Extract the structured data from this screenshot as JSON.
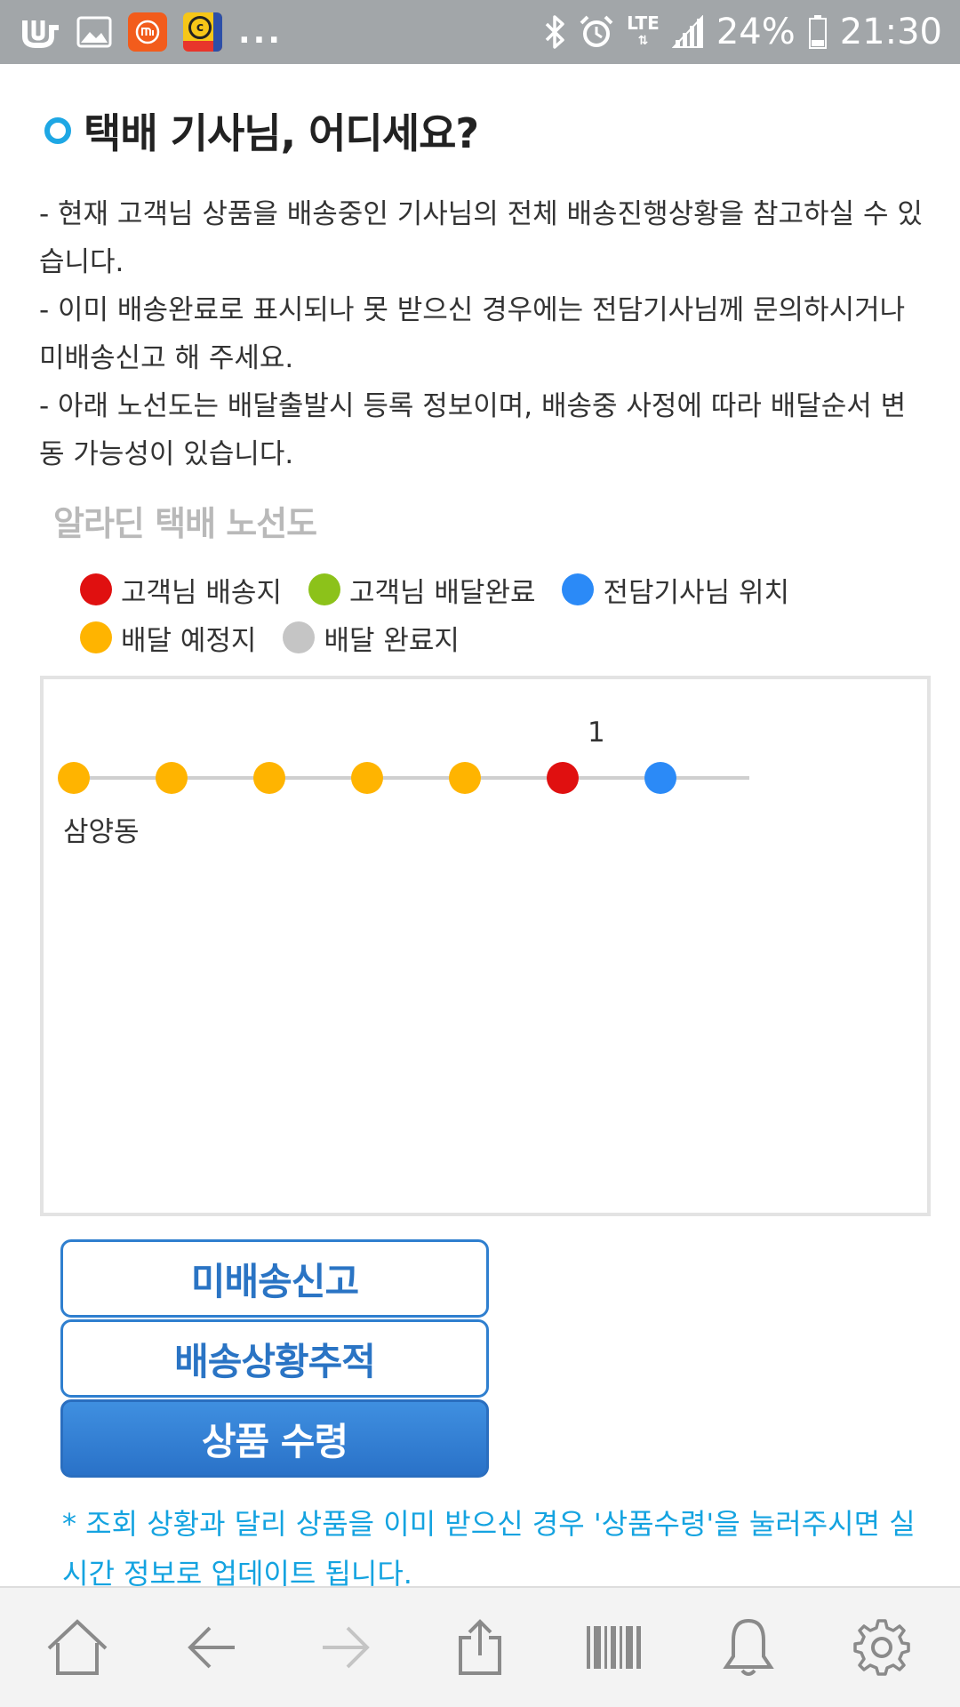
{
  "status_bar": {
    "icons_left": [
      "uplus-app-icon",
      "gallery-icon",
      "mi-app-icon",
      "copyright-app-icon"
    ],
    "overflow": "...",
    "network": "LTE",
    "battery": "24%",
    "time": "21:30",
    "icons_right": [
      "bluetooth-icon",
      "alarm-icon",
      "signal-icon",
      "battery-icon"
    ]
  },
  "page": {
    "section_title": "택배 기사님, 어디세요?",
    "notes": [
      "- 현재 고객님 상품을 배송중인 기사님의 전체 배송진행상황을 참고하실 수 있습니다.",
      "- 이미 배송완료로 표시되나 못 받으신 경우에는 전담기사님께 문의하시거나 미배송신고 해 주세요.",
      "- 아래 노선도는 배달출발시 등록 정보이며, 배송중 사정에 따라 배달순서 변동 가능성이 있습니다."
    ],
    "route_heading": "알라딘 택배 노선도"
  },
  "legend": {
    "items": [
      {
        "label": "고객님 배송지",
        "color": "#e01010"
      },
      {
        "label": "고객님 배달완료",
        "color": "#8cc21a"
      },
      {
        "label": "전담기사님 위치",
        "color": "#2b8af7"
      },
      {
        "label": "배달 예정지",
        "color": "#ffb400"
      },
      {
        "label": "배달 완료지",
        "color": "#c5c5c5"
      }
    ]
  },
  "route": {
    "start_label": "삼양동",
    "count_label": "1",
    "stops": [
      {
        "status": "배달 예정지",
        "color": "#ffb400"
      },
      {
        "status": "배달 예정지",
        "color": "#ffb400"
      },
      {
        "status": "배달 예정지",
        "color": "#ffb400"
      },
      {
        "status": "배달 예정지",
        "color": "#ffb400"
      },
      {
        "status": "배달 예정지",
        "color": "#ffb400"
      },
      {
        "status": "고객님 배송지",
        "color": "#e01010"
      },
      {
        "status": "전담기사님 위치",
        "color": "#2b8af7"
      }
    ]
  },
  "buttons": {
    "report_undelivered": "미배송신고",
    "track_delivery": "배송상황추적",
    "confirm_receipt": "상품 수령"
  },
  "footnote": "* 조회 상황과 달리 상품을 이미 받으신 경우 '상품수령'을 눌러주시면 실시간 정보로 업데이트 됩니다.",
  "navbar": {
    "items": [
      "home-icon",
      "back-arrow-icon",
      "forward-arrow-icon",
      "share-icon",
      "barcode-icon",
      "bell-icon",
      "gear-icon"
    ],
    "colors": {
      "icon": "#8a8a8a",
      "disabled": "#c4c4c4"
    }
  }
}
